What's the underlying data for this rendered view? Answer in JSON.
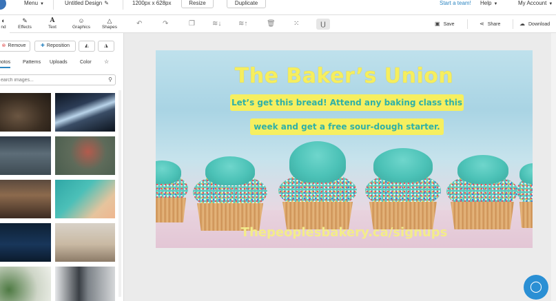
{
  "topbar": {
    "menu_label": "Menu",
    "design_title": "Untitled Design",
    "dimensions": "1200px x 628px",
    "resize_label": "Resize",
    "duplicate_label": "Duplicate",
    "start_team_label": "Start a team!",
    "help_label": "Help",
    "account_label": "My Account"
  },
  "tool_tabs": [
    {
      "label": "nd",
      "icon": "background-icon"
    },
    {
      "label": "Effects",
      "icon": "effects-icon"
    },
    {
      "label": "Text",
      "icon": "text-icon"
    },
    {
      "label": "Graphics",
      "icon": "graphics-icon"
    },
    {
      "label": "Shapes",
      "icon": "shapes-icon"
    }
  ],
  "actions": {
    "save_label": "Save",
    "share_label": "Share",
    "download_label": "Download"
  },
  "panel": {
    "remove_label": "Remove",
    "reposition_label": "Reposition",
    "subtabs": [
      "hotos",
      "Patterns",
      "Uploads",
      "Color"
    ],
    "search_placeholder": "earch images..."
  },
  "canvas": {
    "title": "The Baker’s Union",
    "subtitle_line1": "Let’s get this bread! Attend any baking class this",
    "subtitle_line2": "week and get a free sour-dough starter.",
    "url": "Thepeoplesbakery.ca/signups"
  },
  "colors": {
    "accent": "#2e86c1",
    "title_yellow": "#f6ee5e",
    "subtitle_teal": "#2fb0a8",
    "chat_blue": "#2a8fd4"
  }
}
